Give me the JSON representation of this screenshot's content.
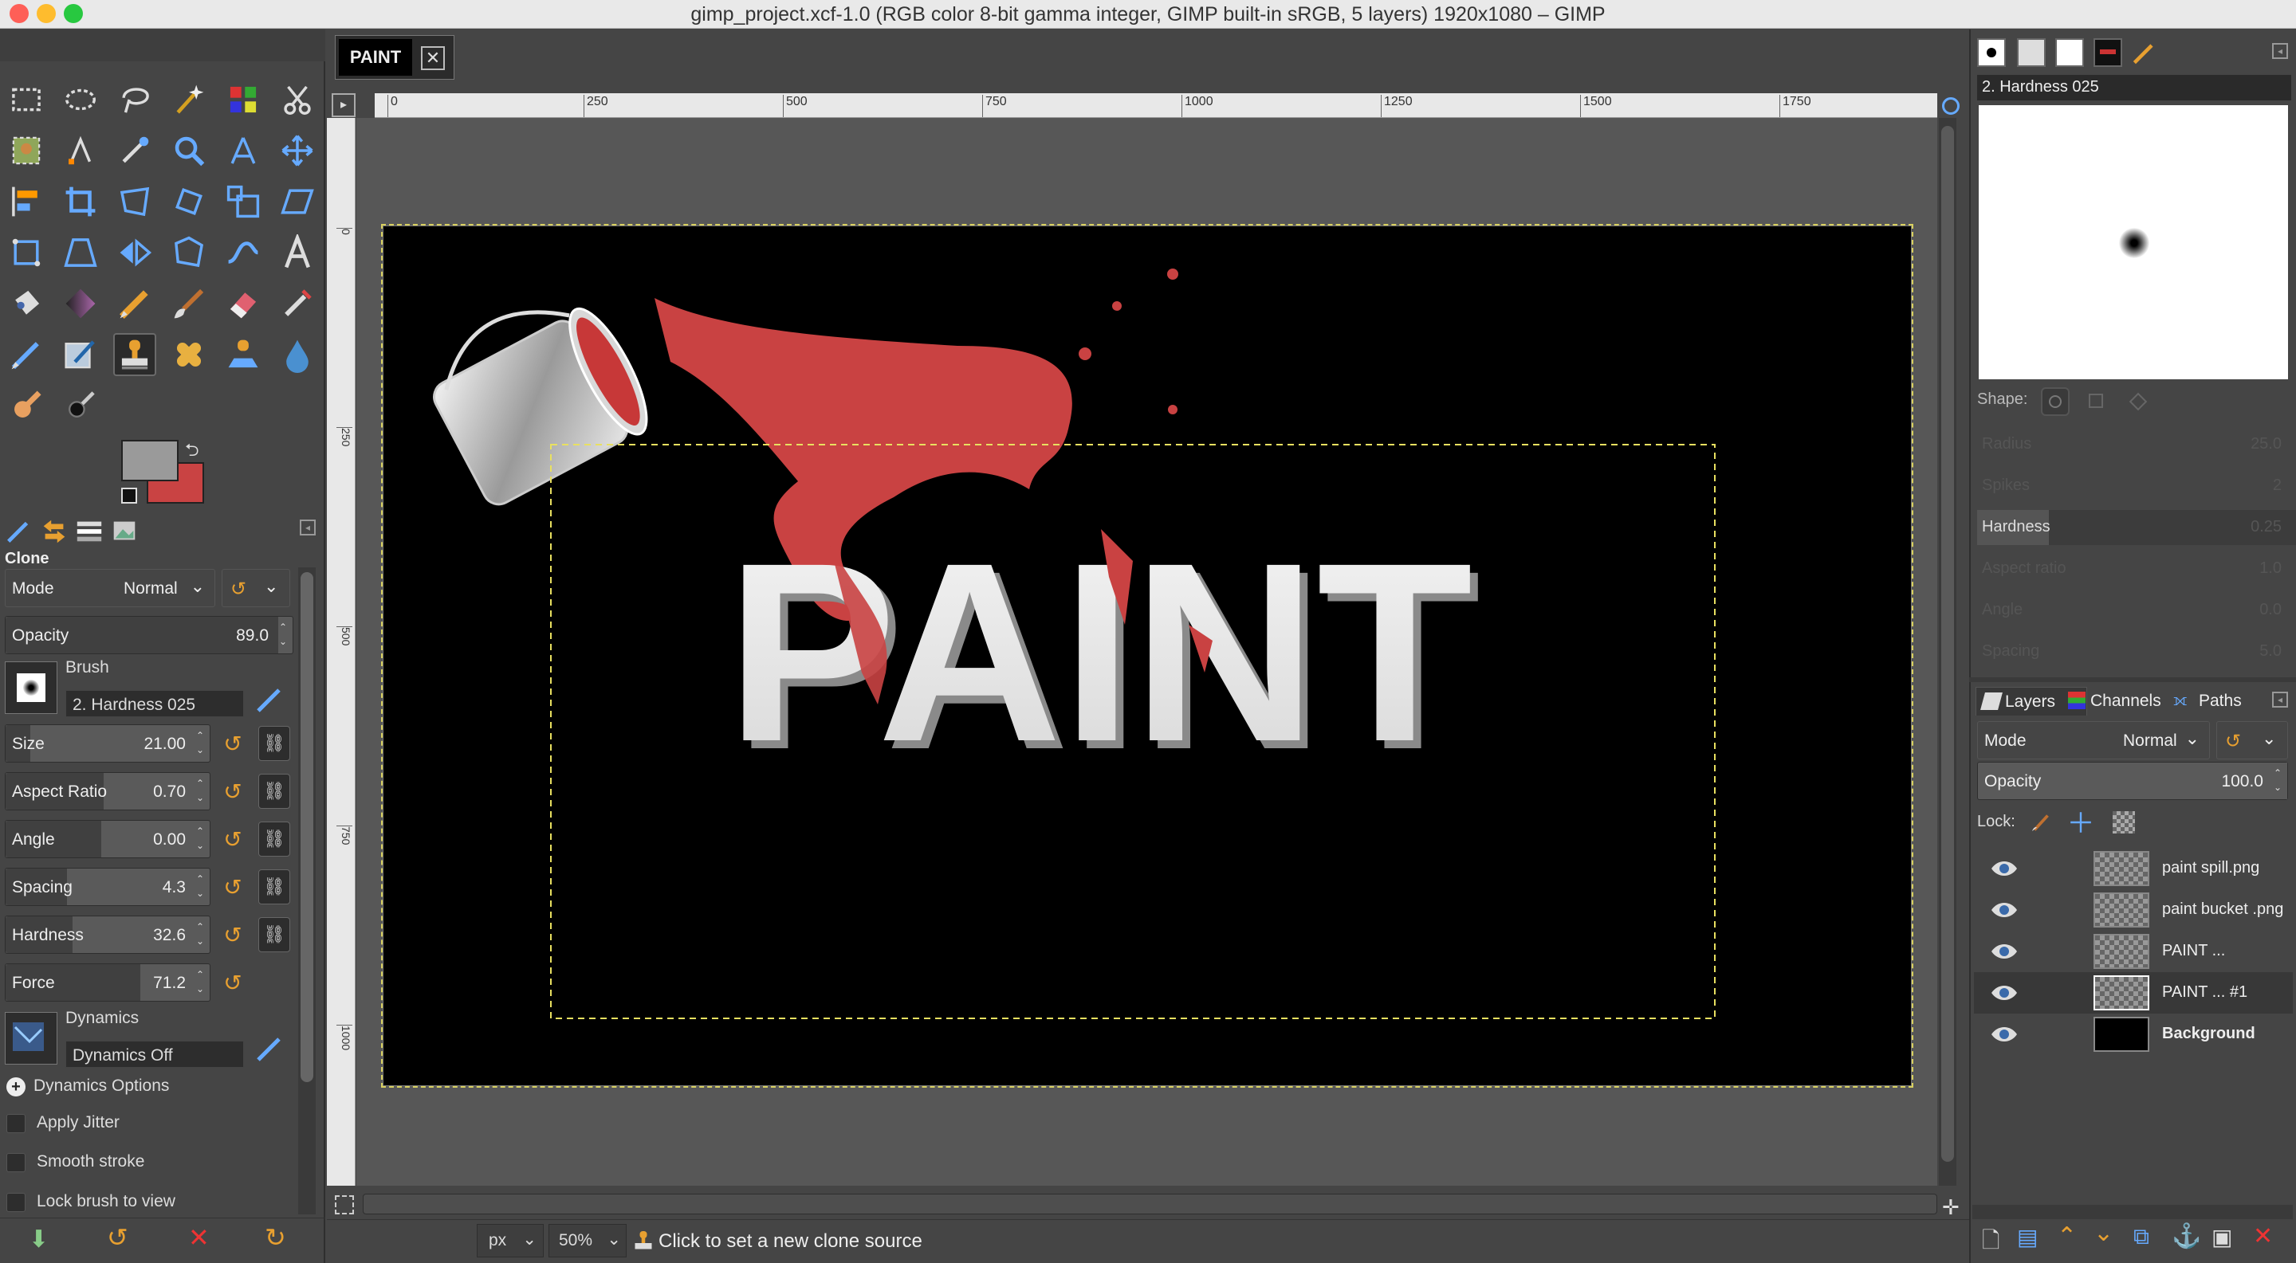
{
  "window": {
    "title": "gimp_project.xcf-1.0 (RGB color 8-bit gamma integer, GIMP built-in sRGB, 5 layers) 1920x1080 – GIMP"
  },
  "image_tab": {
    "thumb_text": "PAINT"
  },
  "toolbox": {
    "tools": [
      "rect-select",
      "ellipse-select",
      "free-select",
      "fuzzy-select",
      "select-by-color",
      "scissors-select",
      "foreground-select",
      "paths",
      "color-picker",
      "zoom",
      "measure",
      "move",
      "align",
      "crop",
      "unified-transform",
      "rotate",
      "scale",
      "shear",
      "handle-transform",
      "perspective",
      "flip",
      "cage-transform",
      "warp-transform",
      "text",
      "bucket-fill",
      "blend",
      "pencil",
      "paintbrush",
      "eraser",
      "airbrush",
      "ink",
      "mypaint-brush",
      "clone",
      "heal",
      "perspective-clone",
      "blur",
      "smudge",
      "dodge-burn"
    ],
    "fg_color": "#9a9a9a",
    "bg_color": "#c94343"
  },
  "tool_options": {
    "title": "Clone",
    "mode_label": "Mode",
    "mode_value": "Normal",
    "opacity_label": "Opacity",
    "opacity_value": "89.0",
    "brush_label": "Brush",
    "brush_name": "2. Hardness 025",
    "size_label": "Size",
    "size_value": "21.00",
    "aspect_label": "Aspect Ratio",
    "aspect_value": "0.70",
    "angle_label": "Angle",
    "angle_value": "0.00",
    "spacing_label": "Spacing",
    "spacing_value": "4.3",
    "hardness_label": "Hardness",
    "hardness_value": "32.6",
    "force_label": "Force",
    "force_value": "71.2",
    "dynamics_label": "Dynamics",
    "dynamics_name": "Dynamics Off",
    "dynamics_options_label": "Dynamics Options",
    "apply_jitter_label": "Apply Jitter",
    "smooth_stroke_label": "Smooth stroke",
    "lock_brush_label": "Lock brush to view"
  },
  "rulers": {
    "h_ticks": [
      "0",
      "250",
      "500",
      "750",
      "1000",
      "1250",
      "1500",
      "1750"
    ],
    "v_ticks": [
      "0",
      "250",
      "500",
      "750",
      "1000"
    ]
  },
  "canvas": {
    "text": "PAINT"
  },
  "statusbar": {
    "unit": "px",
    "zoom": "50%",
    "message": "Click to set a new clone source"
  },
  "brushes_panel": {
    "brush_name": "2. Hardness 025",
    "shape_label": "Shape:",
    "radius_label": "Radius",
    "radius_value": "25.0",
    "spikes_label": "Spikes",
    "spikes_value": "2",
    "hardness_label": "Hardness",
    "hardness_value": "0.25",
    "aspect_label": "Aspect ratio",
    "aspect_value": "1.0",
    "angle_label": "Angle",
    "angle_value": "0.0",
    "spacing_label": "Spacing",
    "spacing_value": "5.0"
  },
  "layers_panel": {
    "tabs": [
      "Layers",
      "Channels",
      "Paths"
    ],
    "mode_label": "Mode",
    "mode_value": "Normal",
    "opacity_label": "Opacity",
    "opacity_value": "100.0",
    "lock_label": "Lock:",
    "layers": [
      {
        "name": "paint spill.png"
      },
      {
        "name": "paint bucket .png"
      },
      {
        "name": "PAINT ..."
      },
      {
        "name": "PAINT ... #1"
      },
      {
        "name": "Background"
      }
    ]
  }
}
